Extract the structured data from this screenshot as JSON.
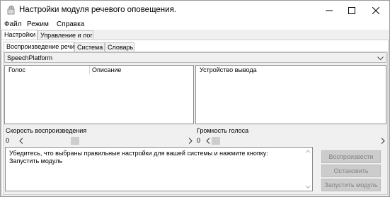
{
  "window": {
    "title": "Настройки модуля речевого оповещения."
  },
  "menu": [
    "Файл",
    "Режим",
    "Справка"
  ],
  "main_tabs": [
    "Настройки",
    "Управление и лог"
  ],
  "sub_tabs": [
    "Воспроизведение речи",
    "Система",
    "Словарь"
  ],
  "engine_combo": {
    "selected": "SpeechPlatform"
  },
  "voices_list": {
    "columns": [
      "Голос",
      "Описание"
    ]
  },
  "devices_list": {
    "columns": [
      "Устройство вывода"
    ]
  },
  "speed": {
    "label": "Скорость воспроизведения",
    "value": "0",
    "level": 0.3
  },
  "volume": {
    "label": "Громкость голоса",
    "value": "0",
    "level": 0.0
  },
  "message": "Убедитесь, что выбраны правильные настройки для вашей системы и нажмите кнопку: Запустить модуль",
  "buttons": {
    "play": "Воспроизвести",
    "stop": "Остановить",
    "start_module": "Запустить модуль"
  },
  "colors": {
    "disabled_button_bg": "#cccccc",
    "disabled_button_text": "#838383"
  }
}
